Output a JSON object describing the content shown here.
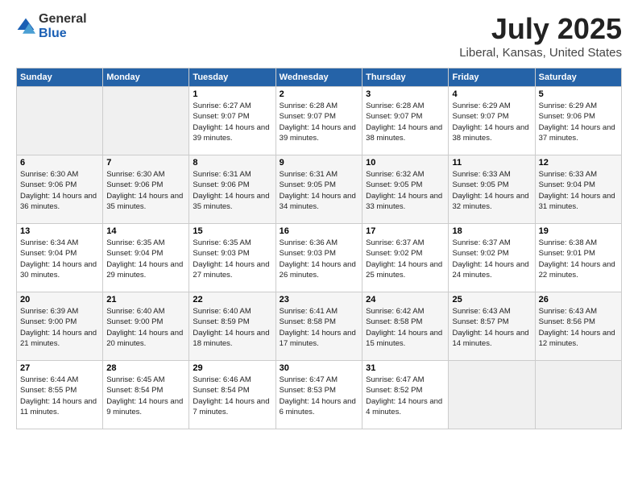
{
  "logo": {
    "general": "General",
    "blue": "Blue"
  },
  "title": "July 2025",
  "subtitle": "Liberal, Kansas, United States",
  "days_of_week": [
    "Sunday",
    "Monday",
    "Tuesday",
    "Wednesday",
    "Thursday",
    "Friday",
    "Saturday"
  ],
  "weeks": [
    [
      {
        "day": "",
        "info": ""
      },
      {
        "day": "",
        "info": ""
      },
      {
        "day": "1",
        "info": "Sunrise: 6:27 AM\nSunset: 9:07 PM\nDaylight: 14 hours and 39 minutes."
      },
      {
        "day": "2",
        "info": "Sunrise: 6:28 AM\nSunset: 9:07 PM\nDaylight: 14 hours and 39 minutes."
      },
      {
        "day": "3",
        "info": "Sunrise: 6:28 AM\nSunset: 9:07 PM\nDaylight: 14 hours and 38 minutes."
      },
      {
        "day": "4",
        "info": "Sunrise: 6:29 AM\nSunset: 9:07 PM\nDaylight: 14 hours and 38 minutes."
      },
      {
        "day": "5",
        "info": "Sunrise: 6:29 AM\nSunset: 9:06 PM\nDaylight: 14 hours and 37 minutes."
      }
    ],
    [
      {
        "day": "6",
        "info": "Sunrise: 6:30 AM\nSunset: 9:06 PM\nDaylight: 14 hours and 36 minutes."
      },
      {
        "day": "7",
        "info": "Sunrise: 6:30 AM\nSunset: 9:06 PM\nDaylight: 14 hours and 35 minutes."
      },
      {
        "day": "8",
        "info": "Sunrise: 6:31 AM\nSunset: 9:06 PM\nDaylight: 14 hours and 35 minutes."
      },
      {
        "day": "9",
        "info": "Sunrise: 6:31 AM\nSunset: 9:05 PM\nDaylight: 14 hours and 34 minutes."
      },
      {
        "day": "10",
        "info": "Sunrise: 6:32 AM\nSunset: 9:05 PM\nDaylight: 14 hours and 33 minutes."
      },
      {
        "day": "11",
        "info": "Sunrise: 6:33 AM\nSunset: 9:05 PM\nDaylight: 14 hours and 32 minutes."
      },
      {
        "day": "12",
        "info": "Sunrise: 6:33 AM\nSunset: 9:04 PM\nDaylight: 14 hours and 31 minutes."
      }
    ],
    [
      {
        "day": "13",
        "info": "Sunrise: 6:34 AM\nSunset: 9:04 PM\nDaylight: 14 hours and 30 minutes."
      },
      {
        "day": "14",
        "info": "Sunrise: 6:35 AM\nSunset: 9:04 PM\nDaylight: 14 hours and 29 minutes."
      },
      {
        "day": "15",
        "info": "Sunrise: 6:35 AM\nSunset: 9:03 PM\nDaylight: 14 hours and 27 minutes."
      },
      {
        "day": "16",
        "info": "Sunrise: 6:36 AM\nSunset: 9:03 PM\nDaylight: 14 hours and 26 minutes."
      },
      {
        "day": "17",
        "info": "Sunrise: 6:37 AM\nSunset: 9:02 PM\nDaylight: 14 hours and 25 minutes."
      },
      {
        "day": "18",
        "info": "Sunrise: 6:37 AM\nSunset: 9:02 PM\nDaylight: 14 hours and 24 minutes."
      },
      {
        "day": "19",
        "info": "Sunrise: 6:38 AM\nSunset: 9:01 PM\nDaylight: 14 hours and 22 minutes."
      }
    ],
    [
      {
        "day": "20",
        "info": "Sunrise: 6:39 AM\nSunset: 9:00 PM\nDaylight: 14 hours and 21 minutes."
      },
      {
        "day": "21",
        "info": "Sunrise: 6:40 AM\nSunset: 9:00 PM\nDaylight: 14 hours and 20 minutes."
      },
      {
        "day": "22",
        "info": "Sunrise: 6:40 AM\nSunset: 8:59 PM\nDaylight: 14 hours and 18 minutes."
      },
      {
        "day": "23",
        "info": "Sunrise: 6:41 AM\nSunset: 8:58 PM\nDaylight: 14 hours and 17 minutes."
      },
      {
        "day": "24",
        "info": "Sunrise: 6:42 AM\nSunset: 8:58 PM\nDaylight: 14 hours and 15 minutes."
      },
      {
        "day": "25",
        "info": "Sunrise: 6:43 AM\nSunset: 8:57 PM\nDaylight: 14 hours and 14 minutes."
      },
      {
        "day": "26",
        "info": "Sunrise: 6:43 AM\nSunset: 8:56 PM\nDaylight: 14 hours and 12 minutes."
      }
    ],
    [
      {
        "day": "27",
        "info": "Sunrise: 6:44 AM\nSunset: 8:55 PM\nDaylight: 14 hours and 11 minutes."
      },
      {
        "day": "28",
        "info": "Sunrise: 6:45 AM\nSunset: 8:54 PM\nDaylight: 14 hours and 9 minutes."
      },
      {
        "day": "29",
        "info": "Sunrise: 6:46 AM\nSunset: 8:54 PM\nDaylight: 14 hours and 7 minutes."
      },
      {
        "day": "30",
        "info": "Sunrise: 6:47 AM\nSunset: 8:53 PM\nDaylight: 14 hours and 6 minutes."
      },
      {
        "day": "31",
        "info": "Sunrise: 6:47 AM\nSunset: 8:52 PM\nDaylight: 14 hours and 4 minutes."
      },
      {
        "day": "",
        "info": ""
      },
      {
        "day": "",
        "info": ""
      }
    ]
  ]
}
